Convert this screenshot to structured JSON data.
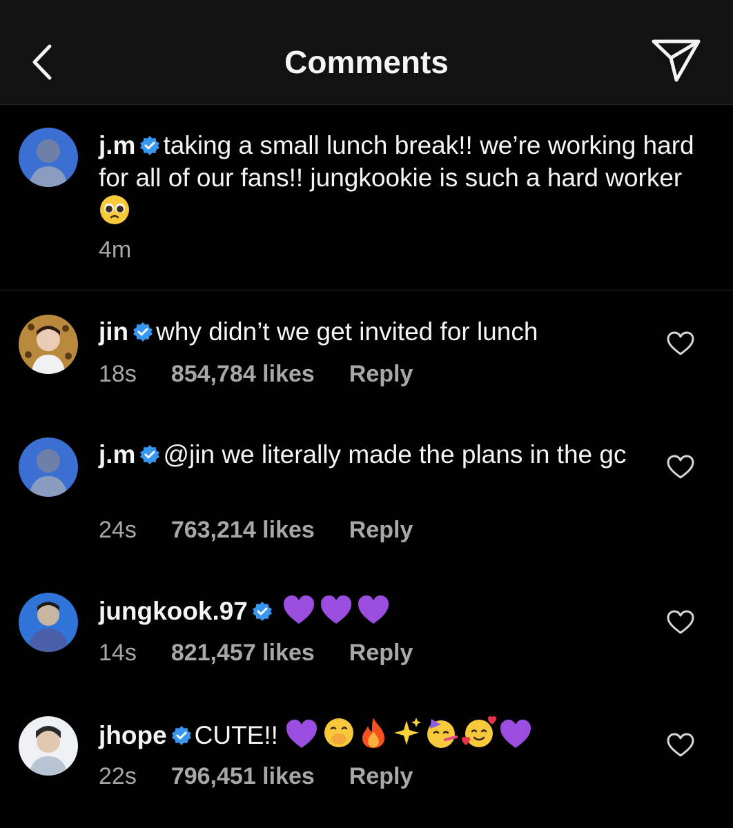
{
  "header": {
    "title": "Comments",
    "back_icon": "chevron-left-icon",
    "share_icon": "paper-plane-icon"
  },
  "caption": {
    "username": "j.m",
    "text": "taking a small lunch break!! we’re working hard for all of our fans!! jungkookie is such a hard worker",
    "emoji": "pleading-face-emoji",
    "time": "4m"
  },
  "comments": [
    {
      "username": "jin",
      "text": "why didn’t we get invited for lunch",
      "time": "18s",
      "likes": "854,784 likes",
      "reply": "Reply"
    },
    {
      "username": "j.m",
      "text": "@jin we literally made the plans in the gc",
      "time": "24s",
      "likes": "763,214 likes",
      "reply": "Reply"
    },
    {
      "username": "jungkook.97",
      "text": "",
      "emojis": [
        "purple-heart",
        "purple-heart",
        "purple-heart"
      ],
      "time": "14s",
      "likes": "821,457 likes",
      "reply": "Reply"
    },
    {
      "username": "jhope",
      "text": "CUTE!!",
      "emojis": [
        "purple-heart",
        "hand-over-mouth",
        "fire",
        "sparkles",
        "partying-face",
        "smiling-face-with-hearts",
        "purple-heart"
      ],
      "time": "22s",
      "likes": "796,451 likes",
      "reply": "Reply"
    }
  ],
  "colors": {
    "background": "#000000",
    "header_bg": "#121212",
    "text": "#f5f5f5",
    "meta": "#a8a8a8",
    "verified": "#3897f0",
    "purple_heart": "#9b4de0"
  }
}
